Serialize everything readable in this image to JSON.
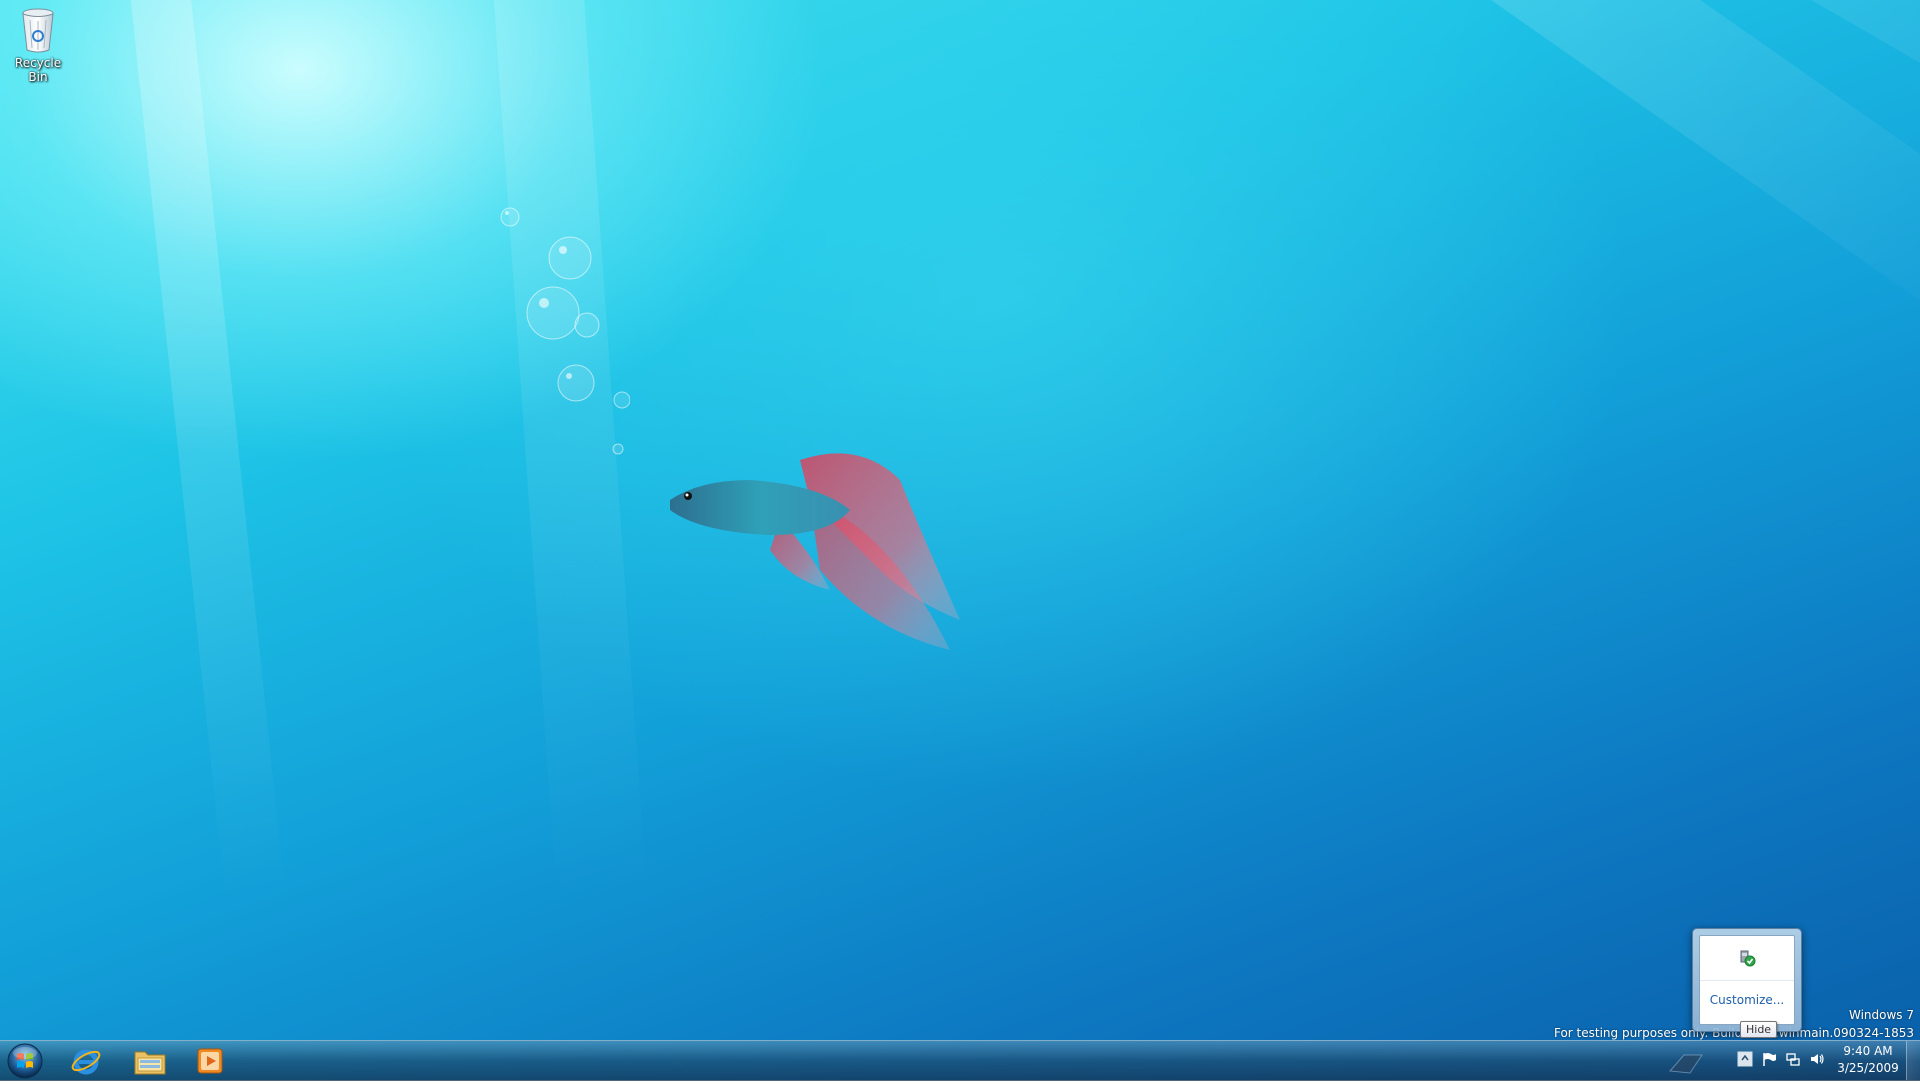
{
  "desktop": {
    "icons": [
      {
        "label": "Recycle Bin",
        "icon": "recycle-bin-icon"
      }
    ],
    "watermark": {
      "line1": "Windows 7",
      "line2": "For testing purposes only. Build 7xxx.winmain.090324-1853"
    }
  },
  "tray_overflow": {
    "customize_label": "Customize...",
    "icon": "safely-remove-hardware-icon"
  },
  "tooltip": {
    "text": "Hide"
  },
  "taskbar": {
    "start_icon": "windows-orb-icon",
    "pinned": [
      {
        "name": "Internet Explorer",
        "icon": "internet-explorer-icon"
      },
      {
        "name": "Windows Explorer",
        "icon": "folder-explorer-icon"
      },
      {
        "name": "Windows Media Player",
        "icon": "media-player-icon"
      }
    ],
    "tray_icons": [
      "show-hidden-icons-icon",
      "action-center-flag-icon",
      "network-icon",
      "volume-icon"
    ],
    "clock": {
      "time": "9:40 AM",
      "date": "3/25/2009"
    }
  },
  "colors": {
    "accent": "#1f5ea8",
    "taskbar": "#1e4a6e"
  }
}
